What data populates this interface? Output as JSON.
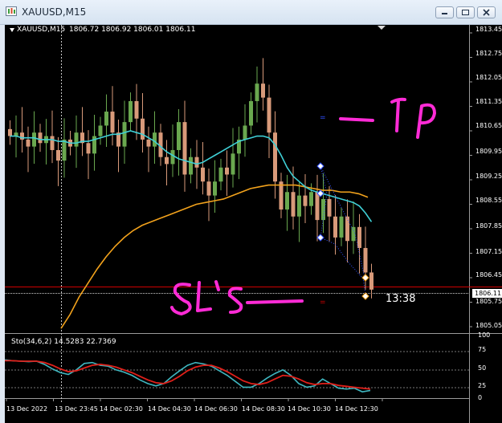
{
  "window": {
    "title": "XAUUSD,M15"
  },
  "chart_header": {
    "symbol": "XAUUSD,M15",
    "ohlc": "1806.72 1806.92 1806.01 1806.11"
  },
  "countdown": "13:38",
  "annotations": {
    "tp_text": "TP",
    "sl_text": "SL'S"
  },
  "colors": {
    "background": "#000000",
    "bull_candle": "#6aa84f",
    "bear_candle": "#d89a7a",
    "fast_ma": "#3fd0d6",
    "slow_ma": "#f2a21c",
    "price_line": "#d00000",
    "stoch_main": "#3fb7c0",
    "stoch_signal": "#e0201a",
    "annotation": "#ff2bd6"
  },
  "price_axis": [
    "1813.45",
    "1812.75",
    "1812.05",
    "1811.35",
    "1810.65",
    "1809.95",
    "1809.25",
    "1808.55",
    "1807.85",
    "1807.15",
    "1806.45",
    "1806.11",
    "1805.75",
    "1805.05"
  ],
  "current_price": "1806.11",
  "stochastic": {
    "label": "Sto(34,6,2) 14.5283 22.7369",
    "levels": [
      "100",
      "75",
      "50",
      "25",
      "0"
    ]
  },
  "time_axis": [
    "13 Dec 2022",
    "13 Dec 23:45",
    "14 Dec 02:30",
    "14 Dec 04:30",
    "14 Dec 06:30",
    "14 Dec 08:30",
    "14 Dec 10:30",
    "14 Dec 12:30"
  ],
  "chart_data": {
    "type": "candlestick",
    "price_range": [
      1805.05,
      1813.45
    ],
    "closes_approx": [
      1810.5,
      1810.6,
      1810.4,
      1810.2,
      1810.6,
      1810.3,
      1810.5,
      1810.1,
      1809.8,
      1810.4,
      1810.2,
      1810.6,
      1810.3,
      1810.0,
      1810.5,
      1810.8,
      1811.2,
      1810.6,
      1810.2,
      1810.9,
      1811.5,
      1811.0,
      1810.4,
      1810.2,
      1810.6,
      1809.9,
      1809.7,
      1810.1,
      1810.9,
      1809.4,
      1809.9,
      1809.6,
      1809.2,
      1808.8,
      1809.2,
      1809.6,
      1809.4,
      1810.0,
      1810.4,
      1810.8,
      1811.5,
      1812.0,
      1811.6,
      1810.6,
      1809.2,
      1808.4,
      1808.9,
      1808.2,
      1808.8,
      1808.5,
      1808.9,
      1808.1,
      1808.7,
      1808.2,
      1807.6,
      1808.2,
      1807.5,
      1807.9,
      1807.3,
      1806.6,
      1806.11
    ],
    "fast_ma_approx": [
      1810.5,
      1810.5,
      1810.45,
      1810.45,
      1810.45,
      1810.4,
      1810.4,
      1810.4,
      1810.35,
      1810.35,
      1810.3,
      1810.3,
      1810.35,
      1810.35,
      1810.4,
      1810.45,
      1810.5,
      1810.55,
      1810.55,
      1810.6,
      1810.65,
      1810.6,
      1810.55,
      1810.45,
      1810.35,
      1810.2,
      1810.05,
      1809.95,
      1809.85,
      1809.8,
      1809.75,
      1809.7,
      1809.75,
      1809.85,
      1809.95,
      1810.05,
      1810.15,
      1810.25,
      1810.35,
      1810.4,
      1810.45,
      1810.5,
      1810.5,
      1810.45,
      1810.25,
      1809.95,
      1809.6,
      1809.35,
      1809.2,
      1809.05,
      1808.95,
      1808.9,
      1808.85,
      1808.8,
      1808.75,
      1808.7,
      1808.65,
      1808.6,
      1808.5,
      1808.3,
      1808.05
    ],
    "slow_ma_approx": [
      1805.0,
      1805.4,
      1805.9,
      1806.3,
      1806.7,
      1807.05,
      1807.35,
      1807.6,
      1807.8,
      1807.95,
      1808.05,
      1808.15,
      1808.25,
      1808.35,
      1808.45,
      1808.55,
      1808.6,
      1808.65,
      1808.7,
      1808.8,
      1808.9,
      1809.0,
      1809.05,
      1809.1,
      1809.1,
      1809.1,
      1809.1,
      1809.05,
      1809.0,
      1808.95,
      1808.95,
      1808.9,
      1808.9,
      1808.85,
      1808.75
    ]
  }
}
